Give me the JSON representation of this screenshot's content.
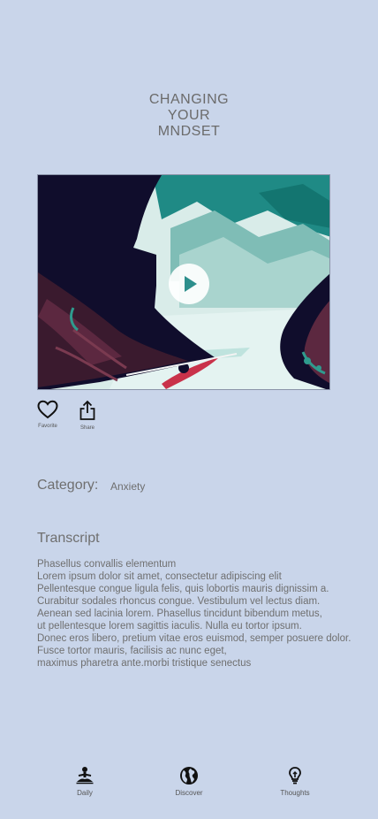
{
  "header": {
    "title": "CHANGING\nYOUR\nMNDSET"
  },
  "video": {
    "thumbnail_icon": "kayak-river-illustration",
    "play_icon": "play-icon"
  },
  "actions": {
    "favorite": {
      "label": "Favorite",
      "icon": "heart-icon"
    },
    "share": {
      "label": "Share",
      "icon": "share-icon"
    }
  },
  "category": {
    "label": "Category:",
    "value": "Anxiety"
  },
  "transcript": {
    "title": "Transcript",
    "lines": [
      "Phasellus convallis elementum",
      "Lorem ipsum dolor sit amet, consectetur adipiscing elit",
      "Pellentesque congue ligula felis, quis lobortis mauris dignissim a.",
      "Curabitur sodales rhoncus congue. Vestibulum vel lectus diam.",
      "Aenean sed lacinia lorem. Phasellus tincidunt bibendum metus,",
      "ut pellentesque lorem sagittis iaculis. Nulla eu tortor ipsum.",
      "Donec eros libero, pretium vitae eros euismod, semper posuere dolor.",
      "Fusce tortor mauris, facilisis ac nunc eget,",
      "maximus pharetra ante.morbi tristique senectus"
    ]
  },
  "nav": {
    "daily": {
      "label": "Daily",
      "icon": "meditation-icon"
    },
    "discover": {
      "label": "Discover",
      "icon": "globe-icon"
    },
    "thoughts": {
      "label": "Thoughts",
      "icon": "lightbulb-icon"
    }
  }
}
